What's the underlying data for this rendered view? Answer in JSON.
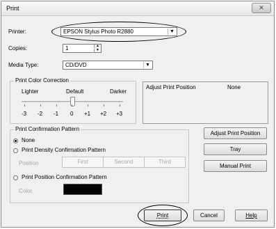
{
  "window": {
    "title": "Print",
    "close_glyph": "✕"
  },
  "printer": {
    "label": "Printer:",
    "value": "EPSON Stylus Photo R2880"
  },
  "copies": {
    "label": "Copies:",
    "value": "1"
  },
  "media_type": {
    "label": "Media Type:",
    "value": "CD/DVD"
  },
  "color_correction": {
    "title": "Print Color Correction",
    "lighter": "Lighter",
    "default": "Default",
    "darker": "Darker",
    "scale": [
      "-3",
      "-2",
      "-1",
      "0",
      "+1",
      "+2",
      "+3"
    ]
  },
  "adjust_panel": {
    "label": "Adjust Print Position",
    "value": "None"
  },
  "confirmation": {
    "title": "Print Confirmation Pattern",
    "none": "None",
    "density": "Print Density Confirmation Pattern",
    "position_label": "Position",
    "segments": [
      "First",
      "Second",
      "Third"
    ],
    "position_pattern": "Print Position Confirmation Pattern",
    "color_label": "Color",
    "swatch_color": "#000000"
  },
  "buttons": {
    "adjust": "Adjust Print Position",
    "tray": "Tray",
    "manual": "Manual Print",
    "print": "Print",
    "cancel": "Cancel",
    "help": "Help"
  }
}
